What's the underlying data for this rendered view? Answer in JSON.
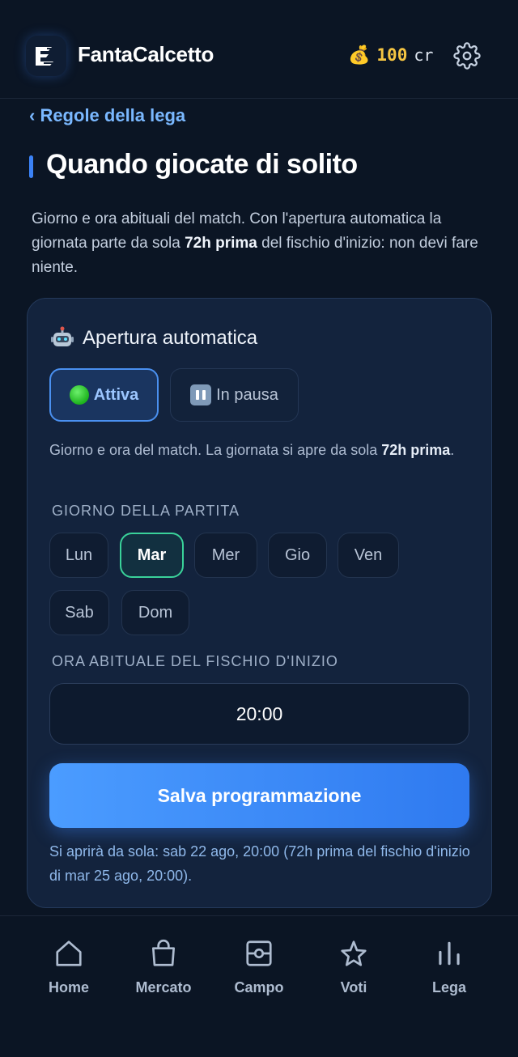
{
  "header": {
    "app_title": "FantaCalcetto",
    "credits_value": "100",
    "credits_unit": "cr",
    "coin_icon": "money-bag-icon",
    "settings_icon": "gear-icon"
  },
  "nav": {
    "back_label": "‹ Regole della lega"
  },
  "page": {
    "title": "Quando giocate di solito",
    "intro_part1": "Giorno e ora abituali del match. Con l'apertura automatica la giornata parte da sola ",
    "intro_bold": "72h prima",
    "intro_part2": " del fischio d'inizio: non devi fare niente."
  },
  "card": {
    "title": "Apertura automatica",
    "title_icon": "robot-icon",
    "toggle_active": "Attiva",
    "toggle_paused": "In pausa",
    "toggle_selected": "Attiva",
    "desc_part1": "Giorno e ora del match. La giornata si apre da sola ",
    "desc_bold": "72h prima",
    "desc_part2": ".",
    "day_label": "GIORNO DELLA PARTITA",
    "days": [
      "Lun",
      "Mar",
      "Mer",
      "Gio",
      "Ven",
      "Sab",
      "Dom"
    ],
    "selected_day": "Mar",
    "time_label": "ORA ABITUALE DEL FISCHIO D'INIZIO",
    "time_value": "20:00",
    "save_label": "Salva programmazione",
    "note": "Si aprirà da sola: sab 22 ago, 20:00 (72h prima del fischio d'inizio di mar 25 ago, 20:00)."
  },
  "bottom_nav": {
    "items": [
      {
        "label": "Home",
        "icon": "home-icon"
      },
      {
        "label": "Mercato",
        "icon": "bag-icon"
      },
      {
        "label": "Campo",
        "icon": "pitch-icon"
      },
      {
        "label": "Voti",
        "icon": "star-icon"
      },
      {
        "label": "Lega",
        "icon": "bar-chart-icon"
      }
    ]
  },
  "colors": {
    "background": "#0b1524",
    "accent": "#3b82f6",
    "selected_day_border": "#3ad29a",
    "credits": "#f5c542"
  }
}
